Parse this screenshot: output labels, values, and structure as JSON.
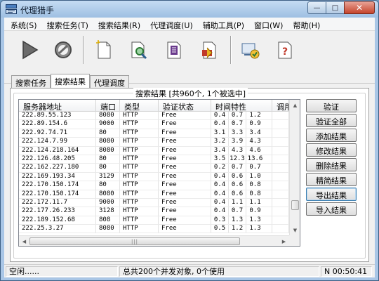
{
  "window": {
    "title": "代理猎手",
    "buttons": {
      "minimize": "—",
      "maximize": "□",
      "close": "✕"
    }
  },
  "menu": [
    "系统(S)",
    "搜索任务(T)",
    "搜索结果(R)",
    "代理调度(U)",
    "辅助工具(P)",
    "窗口(W)",
    "帮助(H)"
  ],
  "toolbar": {
    "icons": [
      "play-icon",
      "stop-icon",
      "new-document-icon",
      "search-document-icon",
      "document-list-icon",
      "import-document-icon",
      "verify-settings-icon",
      "help-icon"
    ]
  },
  "tabs": [
    "搜索任务",
    "搜索结果",
    "代理调度"
  ],
  "active_tab": 1,
  "results": {
    "group_title": "搜索结果 [共960个, 1个被选中]",
    "columns": [
      "服务器地址",
      "端口",
      "类型",
      "验证状态",
      "时间特性",
      "调用"
    ],
    "rows": [
      {
        "address": "222.89.55.123",
        "port": "8080",
        "type": "HTTP",
        "status": "Free",
        "t1": "0.4",
        "t2": "0.7",
        "t3": "1.2"
      },
      {
        "address": "222.89.154.6",
        "port": "9000",
        "type": "HTTP",
        "status": "Free",
        "t1": "0.4",
        "t2": "0.7",
        "t3": "0.9"
      },
      {
        "address": "222.92.74.71",
        "port": "80",
        "type": "HTTP",
        "status": "Free",
        "t1": "3.1",
        "t2": "3.3",
        "t3": "3.4"
      },
      {
        "address": "222.124.7.99",
        "port": "8080",
        "type": "HTTP",
        "status": "Free",
        "t1": "3.2",
        "t2": "3.9",
        "t3": "4.3"
      },
      {
        "address": "222.124.218.164",
        "port": "8080",
        "type": "HTTP",
        "status": "Free",
        "t1": "3.4",
        "t2": "4.3",
        "t3": "4.6"
      },
      {
        "address": "222.126.48.205",
        "port": "80",
        "type": "HTTP",
        "status": "Free",
        "t1": "3.5",
        "t2": "12.3",
        "t3": "13.6"
      },
      {
        "address": "222.162.227.180",
        "port": "80",
        "type": "HTTP",
        "status": "Free",
        "t1": "0.2",
        "t2": "0.7",
        "t3": "0.7"
      },
      {
        "address": "222.169.193.34",
        "port": "3129",
        "type": "HTTP",
        "status": "Free",
        "t1": "0.4",
        "t2": "0.6",
        "t3": "1.0"
      },
      {
        "address": "222.170.150.174",
        "port": "80",
        "type": "HTTP",
        "status": "Free",
        "t1": "0.4",
        "t2": "0.6",
        "t3": "0.8"
      },
      {
        "address": "222.170.150.174",
        "port": "8080",
        "type": "HTTP",
        "status": "Free",
        "t1": "0.4",
        "t2": "0.6",
        "t3": "0.8"
      },
      {
        "address": "222.172.11.7",
        "port": "9000",
        "type": "HTTP",
        "status": "Free",
        "t1": "0.4",
        "t2": "1.1",
        "t3": "1.1"
      },
      {
        "address": "222.177.26.233",
        "port": "3128",
        "type": "HTTP",
        "status": "Free",
        "t1": "0.4",
        "t2": "0.7",
        "t3": "0.9"
      },
      {
        "address": "222.189.152.68",
        "port": "808",
        "type": "HTTP",
        "status": "Free",
        "t1": "0.3",
        "t2": "1.3",
        "t3": "1.3"
      },
      {
        "address": "222.25.3.27",
        "port": "8080",
        "type": "HTTP",
        "status": "Free",
        "t1": "0.5",
        "t2": "1.2",
        "t3": "1.3"
      }
    ],
    "scroll": {
      "vertical_position": 0.86,
      "horizontal_position": 0.0
    }
  },
  "actions": [
    "验证",
    "验证全部",
    "添加结果",
    "修改结果",
    "删除结果",
    "精简结果",
    "导出结果",
    "导入结果"
  ],
  "focused_action": 6,
  "status": {
    "left": "空闲......",
    "middle": "总共200个并发对象, 0个使用",
    "right": "N 00:50:41"
  },
  "colors": {
    "title_bar": "#a9c6e6",
    "close_button": "#c5442b"
  }
}
